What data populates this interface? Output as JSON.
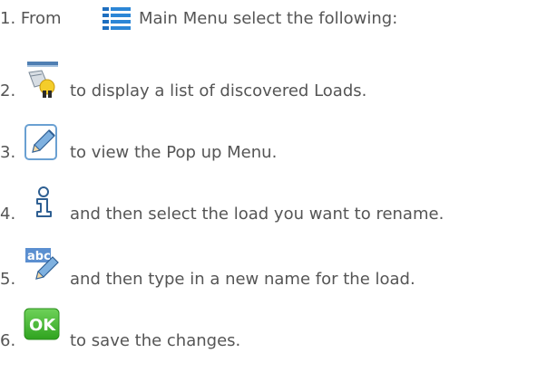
{
  "steps": [
    {
      "num": "1. From",
      "icon": "main-menu-list-icon",
      "text": "Main Menu select the following:"
    },
    {
      "num": "2.",
      "icon": "discovered-loads-icon",
      "text": "to display a list of discovered Loads."
    },
    {
      "num": "3.",
      "icon": "edit-pencil-icon",
      "text": "to view the Pop up Menu."
    },
    {
      "num": "4.",
      "icon": "info-icon",
      "text": "and then select the load you want to rename."
    },
    {
      "num": "5.",
      "icon": "rename-abc-icon",
      "text": "and then type in a new name for the load."
    },
    {
      "num": "6.",
      "icon": "ok-icon",
      "text": "to save the changes."
    }
  ],
  "colors": {
    "text": "#555555",
    "ok_green": "#3cb528",
    "menu_blue": "#1e6fc0"
  }
}
